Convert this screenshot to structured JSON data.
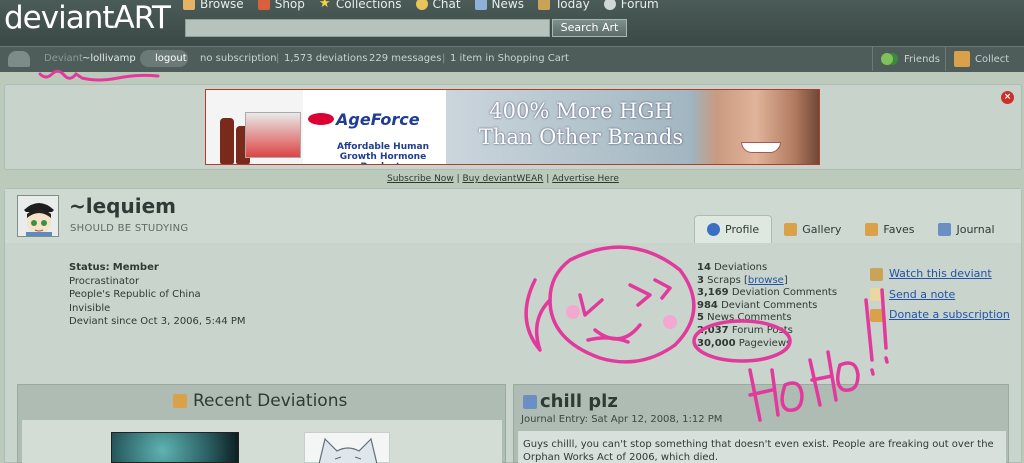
{
  "site": {
    "logo": "deviantART"
  },
  "nav": [
    {
      "label": "Browse",
      "icon": "browse-icon",
      "color": "#e3b36a"
    },
    {
      "label": "Shop",
      "icon": "shop-icon",
      "color": "#d9603f"
    },
    {
      "label": "Collections",
      "icon": "star-icon",
      "color": "#f2d24a"
    },
    {
      "label": "Chat",
      "icon": "smiley-icon",
      "color": "#e8c45a"
    },
    {
      "label": "News",
      "icon": "news-icon",
      "color": "#8fb0d8"
    },
    {
      "label": "Today",
      "icon": "today-icon",
      "color": "#c9a35a"
    },
    {
      "label": "Forum",
      "icon": "forum-icon",
      "color": "#cfd8d6"
    }
  ],
  "search": {
    "button": "Search Art",
    "value": ""
  },
  "userbar": {
    "deviant_label": "Deviant",
    "username": "~lollivamp",
    "logout": "logout",
    "subscription": "no subscription",
    "deviations": "1,573 deviations",
    "messages": "229 messages",
    "cart": "1 item in Shopping Cart",
    "friends": "Friends",
    "collect": "Collect"
  },
  "ad": {
    "brand": "AgeForce",
    "tagline": "Affordable Human Growth Hormone Products",
    "headline_1": "400% More HGH",
    "headline_2": "Than Other Brands",
    "links": [
      "Subscribe Now",
      "Buy deviantWEAR",
      "Advertise Here"
    ],
    "close": "×"
  },
  "profile": {
    "name": "~lequiem",
    "tagline": "SHOULD BE STUDYING",
    "tabs": [
      {
        "label": "Profile",
        "icon": "info-icon",
        "color": "#3a6fc4"
      },
      {
        "label": "Gallery",
        "icon": "gallery-icon",
        "color": "#d9a24a"
      },
      {
        "label": "Faves",
        "icon": "faves-icon",
        "color": "#d9a24a"
      },
      {
        "label": "Journal",
        "icon": "journal-icon",
        "color": "#6b8fc4"
      }
    ],
    "info": {
      "status_label": "Status:",
      "status_value": "Member",
      "line2": "Procrastinator",
      "line3": "People's Republic of China",
      "line4": "Invisible",
      "line5": "Deviant since Oct 3, 2006, 5:44 PM"
    },
    "stats": {
      "deviations_num": "14",
      "deviations_label": "Deviations",
      "scraps_num": "3",
      "scraps_label": "Scraps",
      "scraps_link": "browse",
      "dev_comments_num": "3,169",
      "dev_comments_label": "Deviation Comments",
      "deviant_comments_num": "984",
      "deviant_comments_label": "Deviant Comments",
      "news_comments_num": "5",
      "news_comments_label": "News Comments",
      "forum_posts_num": "2,037",
      "forum_posts_label": "Forum Posts",
      "pageviews_num": "30,000",
      "pageviews_label": "Pageviews"
    },
    "actions": [
      "Watch this deviant",
      "Send a note",
      "Donate a subscription"
    ]
  },
  "recent": {
    "title": "Recent Deviations"
  },
  "journal": {
    "title": "chill plz",
    "date": "Journal Entry: Sat Apr 12, 2008, 1:12 PM",
    "body": "Guys chilll, you can't stop something that doesn't even exist. People are freaking out over the Orphan Works Act of 2006, which died."
  },
  "doodle": {
    "text": "HoHoHo!!",
    "color": "#e23a9c"
  }
}
